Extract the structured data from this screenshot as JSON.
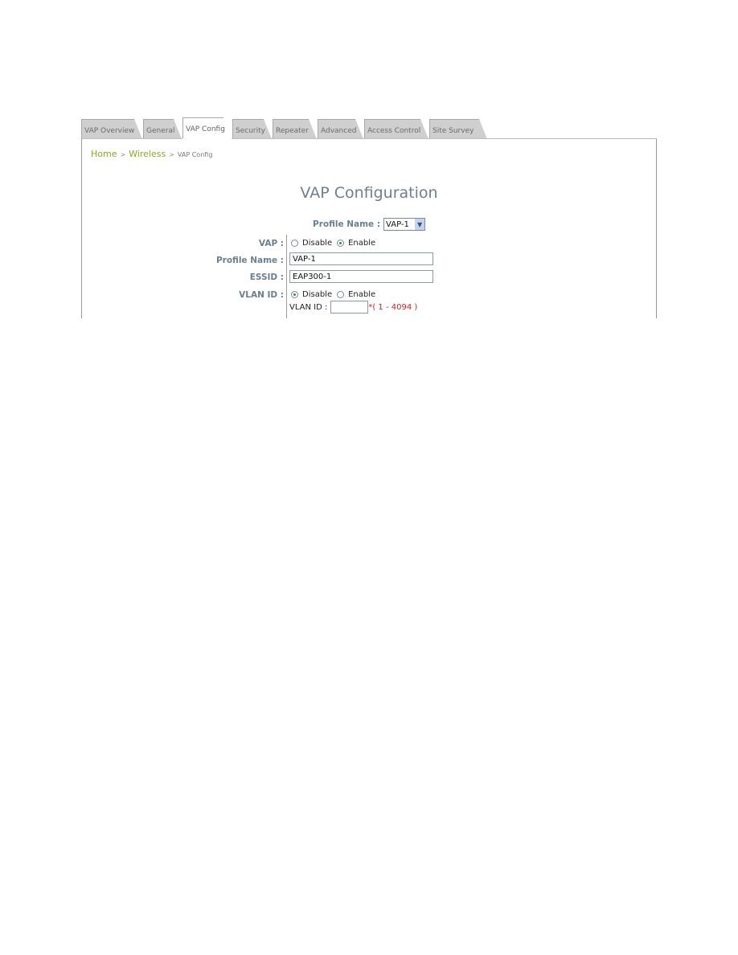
{
  "tabs": [
    {
      "label": "VAP Overview",
      "active": false
    },
    {
      "label": "General",
      "active": false
    },
    {
      "label": "VAP Config",
      "active": true
    },
    {
      "label": "Security",
      "active": false
    },
    {
      "label": "Repeater",
      "active": false
    },
    {
      "label": "Advanced",
      "active": false
    },
    {
      "label": "Access Control",
      "active": false
    },
    {
      "label": "Site Survey",
      "active": false
    }
  ],
  "breadcrumb": {
    "home": "Home",
    "sep": ">",
    "wireless": "Wireless",
    "current": "VAP Config"
  },
  "page_title": "VAP Configuration",
  "profile_selector": {
    "label": "Profile Name :",
    "value": "VAP-1",
    "arrow": "chevron-down"
  },
  "form": {
    "vap": {
      "label": "VAP :",
      "options": [
        "Disable",
        "Enable"
      ],
      "selected": "Enable"
    },
    "profile_name": {
      "label": "Profile Name :",
      "value": "VAP-1"
    },
    "essid": {
      "label": "ESSID :",
      "value": "EAP300-1"
    },
    "vlan": {
      "label": "VLAN ID :",
      "options": [
        "Disable",
        "Enable"
      ],
      "selected": "Disable",
      "id_label": "VLAN ID :",
      "id_value": "",
      "id_hint": "*( 1 - 4094 )"
    }
  },
  "colors": {
    "breadcrumb_link": "#8fa81c",
    "label": "#6a7f8f",
    "title": "#6f7f8d",
    "hint": "#d02020",
    "tab_bg": "#cfcfcf"
  }
}
